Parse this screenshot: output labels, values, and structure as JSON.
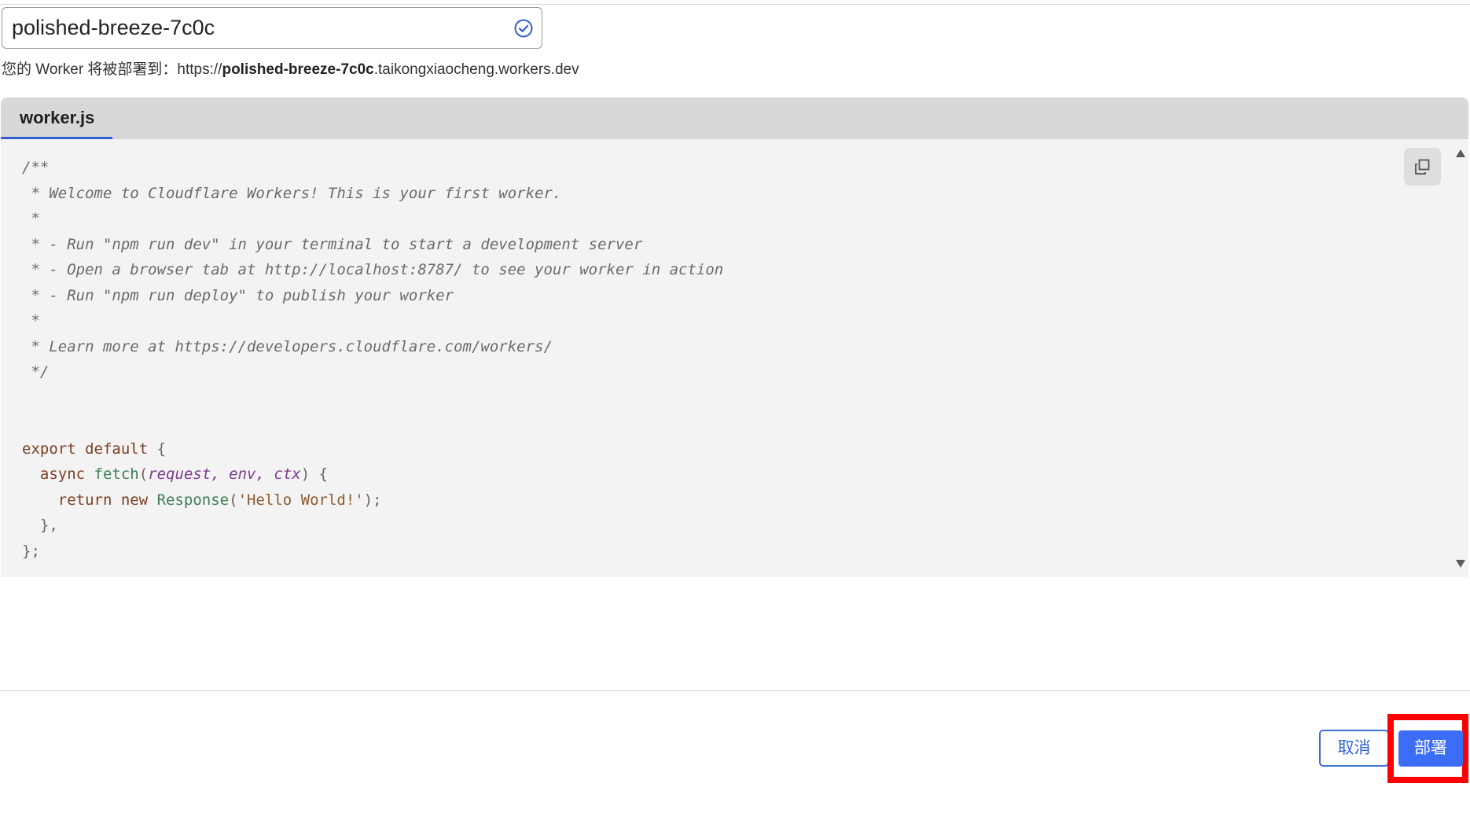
{
  "worker_name": {
    "value": "polished-breeze-7c0c",
    "status_icon": "check-circle-icon",
    "accent_color": "#2f5fd0"
  },
  "deploy_hint": {
    "prefix": "您的 Worker 将被部署到：https://",
    "subdomain": "polished-breeze-7c0c",
    "suffix": ".taikongxiaocheng.workers.dev"
  },
  "editor": {
    "tab_label": "worker.js",
    "copy_icon": "copy-icon",
    "comment_lines": [
      "/**",
      " * Welcome to Cloudflare Workers! This is your first worker.",
      " *",
      " * - Run \"npm run dev\" in your terminal to start a development server",
      " * - Open a browser tab at http://localhost:8787/ to see your worker in action",
      " * - Run \"npm run deploy\" to publish your worker",
      " *",
      " * Learn more at https://developers.cloudflare.com/workers/",
      " */"
    ],
    "code": {
      "export_kw": "export default",
      "open_brace": " {",
      "async_kw": "async",
      "fetch_fn": "fetch",
      "params": [
        "request",
        "env",
        "ctx"
      ],
      "return_kw": "return new",
      "response_fn": "Response",
      "string_literal": "'Hello World!'",
      "close_fn": "  },",
      "close_obj": "};"
    }
  },
  "footer": {
    "cancel_label": "取消",
    "deploy_label": "部署",
    "primary_color": "#3b6df6",
    "highlight_color": "#ff0000"
  }
}
